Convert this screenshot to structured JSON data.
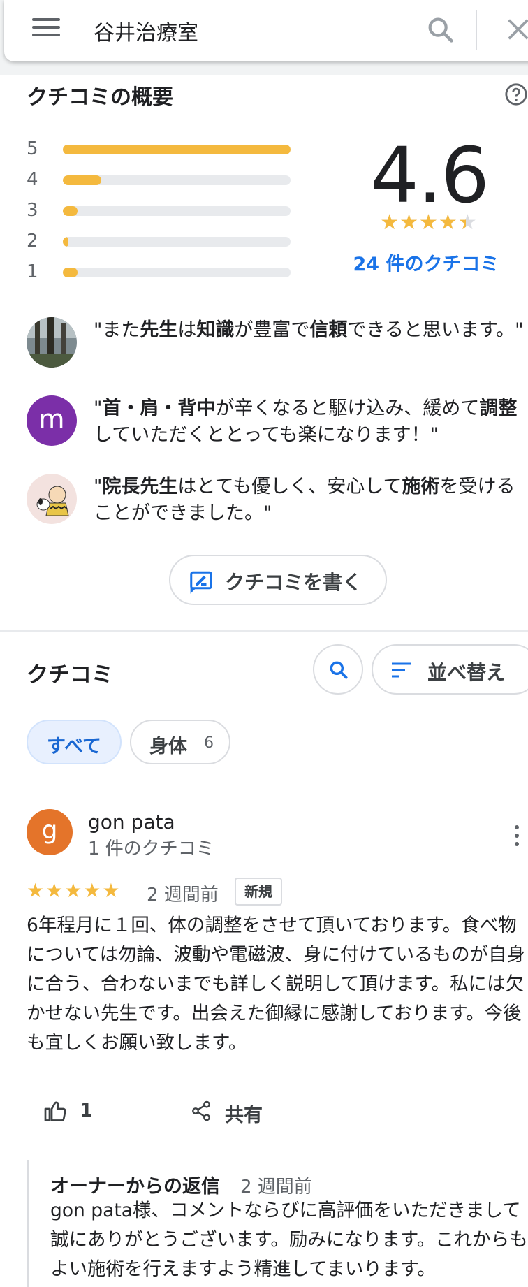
{
  "search": {
    "query": "谷井治療室"
  },
  "overview": {
    "title": "クチコミの概要",
    "rating": "4.6",
    "stars": "★★★★★",
    "review_count_link": "24 件のクチコミ",
    "distribution": [
      {
        "label": "5",
        "fraction": 1.0
      },
      {
        "label": "4",
        "fraction": 0.17
      },
      {
        "label": "3",
        "fraction": 0.065
      },
      {
        "label": "2",
        "fraction": 0.01
      },
      {
        "label": "1",
        "fraction": 0.065
      }
    ]
  },
  "snippets": [
    {
      "text": "\"また先生は知識が豊富で信頼できると思います。\""
    },
    {
      "avatar_letter": "m",
      "text": "\"首・肩・背中が辛くなると駆け込み、緩めて調整していただくととっても楽になります！\""
    },
    {
      "text": "\"院長先生はとても優しく、安心して施術を受けることができました。\""
    }
  ],
  "write_review": {
    "label": "クチコミを書く"
  },
  "reviews_section": {
    "title": "クチコミ",
    "sort_label": "並べ替え",
    "chips": [
      {
        "label": "すべて"
      },
      {
        "label": "身体",
        "count": "6"
      }
    ]
  },
  "review": {
    "avatar_letter": "g",
    "author": "gon pata",
    "author_review_count": "1 件のクチコミ",
    "stars": "★★★★★",
    "time": "2 週間前",
    "badge": "新規",
    "text": "6年程月に１回、体の調整をさせて頂いております。食べ物については勿論、波動や電磁波、身に付けているものが自身に合う、合わないまでも詳しく説明して頂けます。私には欠かせない先生です。出会えた御縁に感謝しております。今後も宜しくお願い致します。",
    "like_count": "1",
    "share_label": "共有"
  },
  "owner_reply": {
    "heading": "オーナーからの返信",
    "time": "2 週間前",
    "text": "gon pata様、コメントならびに高評価をいただきまして誠にありがとうございます。励みになります。これからもよい施術を行えますよう精進してまいります。"
  },
  "colors": {
    "accent": "#1a73e8",
    "star": "#f4b93e",
    "review_avatar": "#e4742a",
    "snippet_avatar_m": "#7b2fa8"
  }
}
